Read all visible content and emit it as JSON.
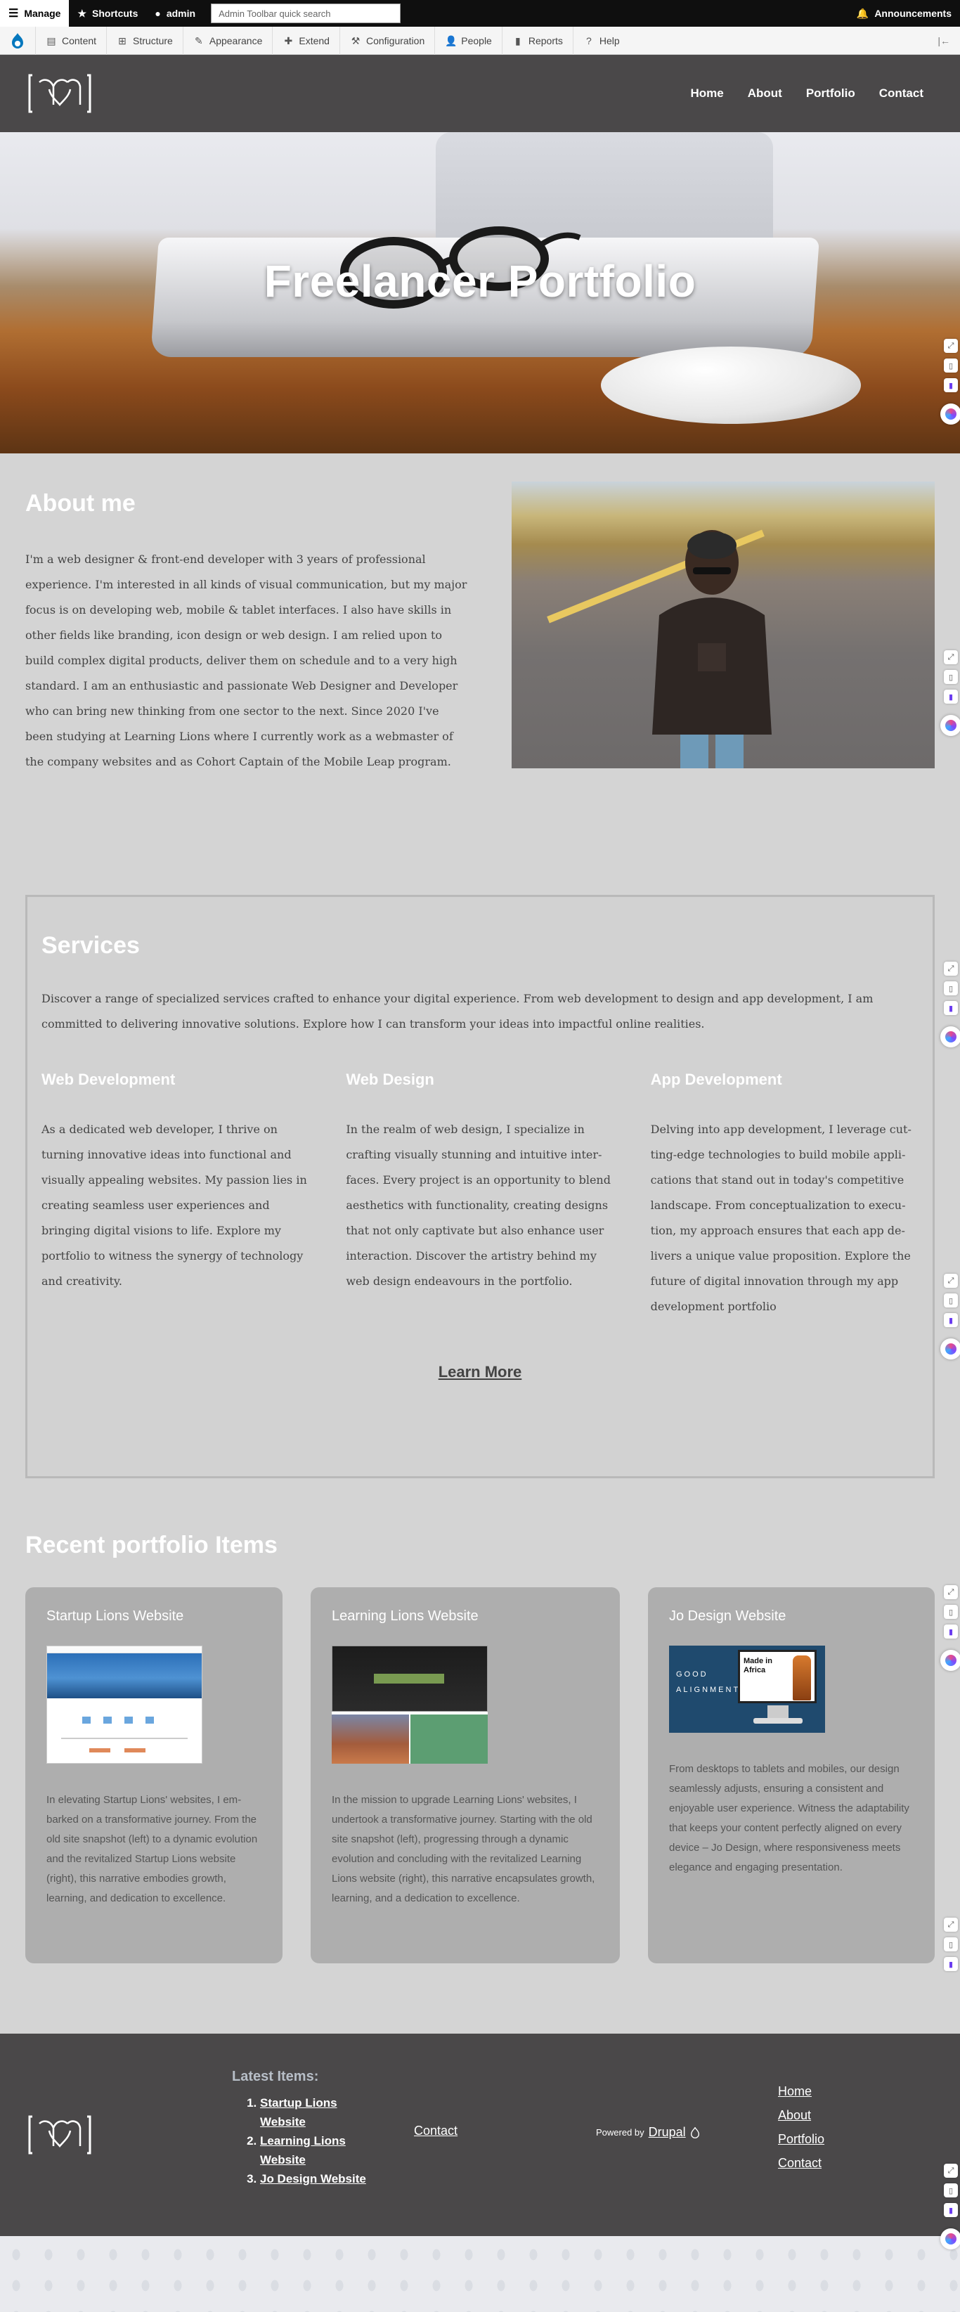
{
  "admin_toolbar": {
    "manage": "Manage",
    "shortcuts": "Shortcuts",
    "user": "admin",
    "search_placeholder": "Admin Toolbar quick search",
    "announcements": "Announcements",
    "tray": [
      {
        "label": "Content",
        "icon": "content-icon"
      },
      {
        "label": "Structure",
        "icon": "structure-icon"
      },
      {
        "label": "Appearance",
        "icon": "appearance-icon"
      },
      {
        "label": "Extend",
        "icon": "extend-icon"
      },
      {
        "label": "Configuration",
        "icon": "configuration-icon"
      },
      {
        "label": "People",
        "icon": "people-icon"
      },
      {
        "label": "Reports",
        "icon": "reports-icon"
      },
      {
        "label": "Help",
        "icon": "help-icon"
      }
    ]
  },
  "header": {
    "nav": [
      "Home",
      "About",
      "Portfolio",
      "Contact"
    ]
  },
  "hero": {
    "title": "Freelancer Portfolio"
  },
  "about": {
    "title": "About me",
    "body": "I'm a web designer & front-end developer with 3 years of professional experience. I'm interested in all kinds of visual communication, but my major focus is on developing web, mobile & tablet interfaces. I also have skills in other fields like branding, icon design or web design. I am relied upon to build complex digital products, deliver them on schedule and to a very high standard. I am an enthusiastic and passionate Web Designer and Developer who can bring new thinking from one sector to the next. Since 2020 I've been studying at Learning Lions where I currently work as a webmaster of the company websites and as Cohort Captain of the Mobile Leap program."
  },
  "services": {
    "title": "Services",
    "intro": "Discover a range of specialized services crafted to enhance your digital experience. From web development to design and app development, I am committed to delivering innovative solutions. Explore how I can transform your ideas into impactful online realities.",
    "items": [
      {
        "title": "Web Development",
        "body": "As a dedicated web developer, I thrive on turning innovative ideas into functional and visually appealing websites. My passion lies in creating seamless user experiences and bringing digital visions to life. Explore my portfolio to witness the synergy of technol­ogy and creativity."
      },
      {
        "title": "Web Design",
        "body": "In the realm of web design, I specialize in crafting visually stunning and intuitive inter­faces. Every project is an opportunity to blend aesthetics with functionality, creating designs that not only captivate but also en­hance user interaction. Discover the artistry behind my web design endeavours in the portfolio."
      },
      {
        "title": "App Development",
        "body": "Delving into app development, I leverage cut­ting-edge technologies to build mobile appli­cations that stand out in today's competitive landscape. From conceptualization to execu­tion, my approach ensures that each app de­livers a unique value proposition. Explore the future of digital innovation through my app development portfolio"
      }
    ],
    "learn_more": "Learn More"
  },
  "portfolio": {
    "title": "Recent portfolio Items",
    "cards": [
      {
        "title": "Startup Lions Website",
        "body": "In elevating Startup Lions' websites, I em­barked on a transformative journey. From the old site snapshot (left) to a dynamic evolution and the revitalized Startup Lions website (right), this narrative embodies growth, learning, and dedication to excellence."
      },
      {
        "title": "Learning Lions Website",
        "body": "In the mission to upgrade Learning Lions' websites, I undertook a transformative journey. Starting with the old site snapshot (left), progressing through a dy­namic evolution and concluding with the revitalized Learning Lions website (right), this narrative encap­sulates growth, learning, and a dedication to excellence."
      },
      {
        "title": "Jo Design Website",
        "body": "From desktops to tablets and mobiles, our de­sign seamlessly adjusts, ensuring a consistent and enjoyable user experience. Witness the adaptability that keeps your content perfectly aligned on every device – Jo Design, where re­sponsiveness meets elegance and engaging presentation.",
        "thumb_left": "GOOD ALIGNMENT",
        "thumb_right": "Made in Africa"
      }
    ]
  },
  "footer": {
    "latest_title": "Latest Items:",
    "latest": [
      "Startup Lions Website",
      "Learning Lions Website",
      "Jo Design Website"
    ],
    "contact": "Contact",
    "powered_by": "Powered by",
    "drupal": "Drupal",
    "nav": [
      "Home",
      "About",
      "Portfolio",
      "Contact"
    ]
  },
  "colors": {
    "header_bg": "#4a4849",
    "page_bg": "#d4d4d4",
    "card_bg": "#aeaeae",
    "toolbar_bg": "#0f0f0f"
  }
}
